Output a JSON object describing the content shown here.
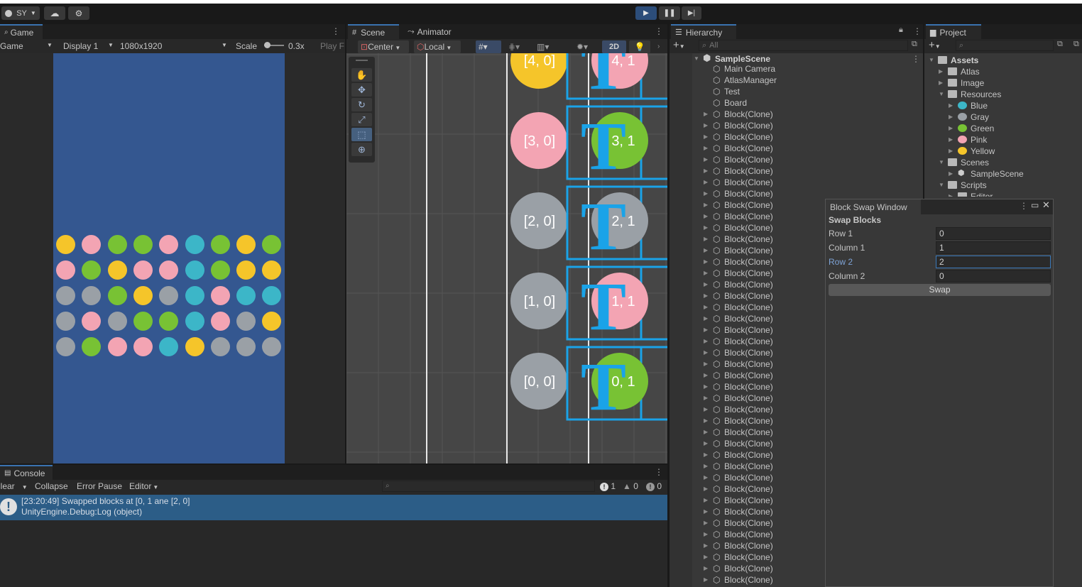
{
  "toolbar": {
    "account": "SY",
    "account_icon": "account-icon",
    "cloud_icon": "cloud-icon",
    "settings_icon": "gear-icon",
    "play_icon": "play-icon",
    "pause_icon": "pause-icon",
    "step_icon": "step-icon"
  },
  "game": {
    "tab": "Game",
    "mode": "Game",
    "display": "Display 1",
    "resolution": "1080x1920",
    "scale_label": "Scale",
    "scale_value": "0.3x",
    "play_focused": "Play F",
    "board": [
      [
        "yellow",
        "pink",
        "green",
        "green",
        "pink",
        "blue",
        "green",
        "yellow",
        "green"
      ],
      [
        "pink",
        "green",
        "yellow",
        "pink",
        "pink",
        "blue",
        "green",
        "yellow",
        "yellow"
      ],
      [
        "gray",
        "gray",
        "green",
        "yellow",
        "gray",
        "blue",
        "pink",
        "blue",
        "blue"
      ],
      [
        "gray",
        "pink",
        "gray",
        "green",
        "green",
        "blue",
        "pink",
        "gray",
        "yellow"
      ],
      [
        "gray",
        "green",
        "pink",
        "pink",
        "blue",
        "yellow",
        "gray",
        "gray",
        "gray"
      ]
    ],
    "colors": {
      "yellow": "#f5c52a",
      "pink": "#f3a4b3",
      "green": "#78c234",
      "gray": "#9aa0a6",
      "blue": "#3cb6c8"
    }
  },
  "scene": {
    "tab": "Scene",
    "tab2": "Animator",
    "pivot": "Center",
    "space": "Local",
    "mode_2d": "2D",
    "labels_left": [
      "[4, 0]",
      "[3, 0]",
      "[2, 0]",
      "[1, 0]",
      "[0, 0]"
    ],
    "labels_right": [
      "4, 1",
      "3, 1",
      "2, 1",
      "1, 1",
      "0, 1"
    ],
    "left_colors": [
      "#f5c52a",
      "#f3a4b3",
      "#9aa0a6",
      "#9aa0a6",
      "#9aa0a6"
    ],
    "right_colors": [
      "#f3a4b3",
      "#78c234",
      "#9aa0a6",
      "#f3a4b3",
      "#78c234"
    ],
    "tools": [
      "hand-tool-icon",
      "move-tool-icon",
      "rotate-tool-icon",
      "scale-tool-icon",
      "rect-tool-icon",
      "transform-tool-icon"
    ]
  },
  "hierarchy": {
    "tab": "Hierarchy",
    "search_placeholder": "All",
    "scene": "SampleScene",
    "top_items": [
      "Main Camera",
      "AtlasManager",
      "Test",
      "Board"
    ],
    "block_label": "Block(Clone)",
    "block_count": 42
  },
  "project": {
    "tab": "Project",
    "tree": [
      {
        "label": "Assets",
        "indent": 0,
        "bold": true,
        "icon": "folder-open-icon",
        "open": true
      },
      {
        "label": "Atlas",
        "indent": 1,
        "icon": "folder-icon"
      },
      {
        "label": "Image",
        "indent": 1,
        "icon": "folder-icon"
      },
      {
        "label": "Resources",
        "indent": 1,
        "icon": "folder-open-icon",
        "open": true
      },
      {
        "label": "Blue",
        "indent": 2,
        "icon": "prefab-blue-icon",
        "color": "#3cb6c8"
      },
      {
        "label": "Gray",
        "indent": 2,
        "icon": "prefab-gray-icon",
        "color": "#9aa0a6"
      },
      {
        "label": "Green",
        "indent": 2,
        "icon": "prefab-green-icon",
        "color": "#78c234"
      },
      {
        "label": "Pink",
        "indent": 2,
        "icon": "prefab-pink-icon",
        "color": "#f3a4b3"
      },
      {
        "label": "Yellow",
        "indent": 2,
        "icon": "prefab-yellow-icon",
        "color": "#f5c52a"
      },
      {
        "label": "Scenes",
        "indent": 1,
        "icon": "folder-open-icon",
        "open": true
      },
      {
        "label": "SampleScene",
        "indent": 2,
        "icon": "unity-scene-icon"
      },
      {
        "label": "Scripts",
        "indent": 1,
        "icon": "folder-open-icon",
        "open": true
      },
      {
        "label": "Editor",
        "indent": 2,
        "icon": "folder-open-icon"
      }
    ]
  },
  "swap_window": {
    "title": "Block Swap Window",
    "heading": "Swap Blocks",
    "row1_label": "Row 1",
    "row1_value": "0",
    "col1_label": "Column 1",
    "col1_value": "1",
    "row2_label": "Row 2",
    "row2_value": "2",
    "col2_label": "Column 2",
    "col2_value": "0",
    "button": "Swap"
  },
  "console": {
    "tab": "Console",
    "clear": "Clear",
    "collapse": "Collapse",
    "error_pause": "Error Pause",
    "editor": "Editor",
    "count_log": "1",
    "count_warn": "0",
    "count_error": "0",
    "message_line1": "[23:20:49] Swapped blocks at [0, 1 ane [2, 0]",
    "message_line2": "UnityEngine.Debug:Log (object)"
  }
}
